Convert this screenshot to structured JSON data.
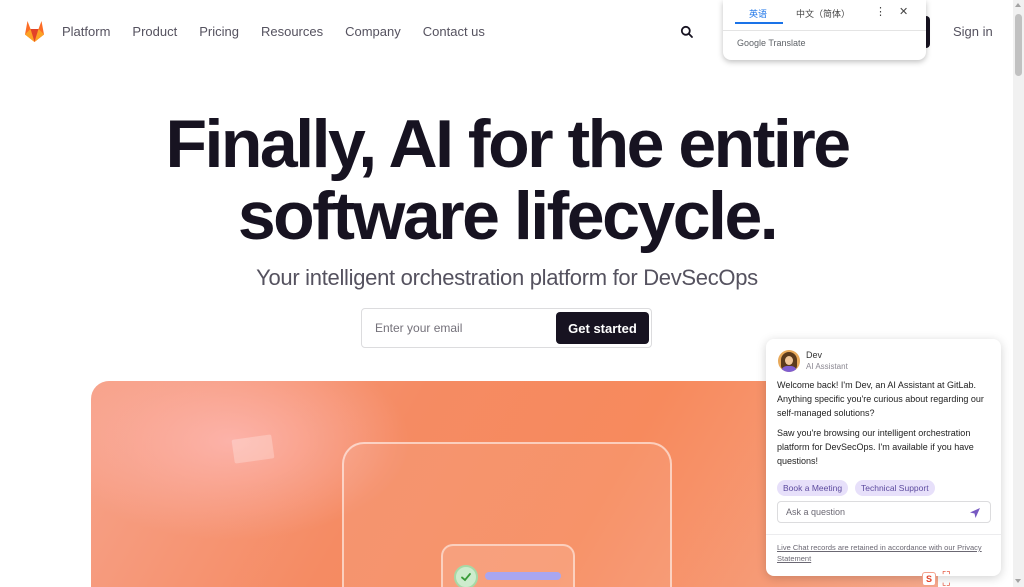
{
  "nav": {
    "logo_icon": "gitlab-tanuki-icon",
    "links": [
      "Platform",
      "Product",
      "Pricing",
      "Resources",
      "Company",
      "Contact us"
    ],
    "search_icon": "search-icon",
    "sign_in": "Sign in"
  },
  "translate_popup": {
    "tab_source": "英语",
    "tab_target": "中文（简体）",
    "more_icon": "more-vertical-icon",
    "close_icon": "close-icon",
    "brand": "Google Translate"
  },
  "hero": {
    "title_line1": "Finally, AI for the entire",
    "title_line2": "software lifecycle.",
    "subtitle": "Your intelligent orchestration platform for DevSecOps",
    "email_placeholder": "Enter your email",
    "cta": "Get started"
  },
  "chat": {
    "agent_name": "Dev",
    "agent_role": "AI Assistant",
    "message1": "Welcome back! I'm Dev, an AI Assistant at GitLab. Anything specific you're curious about regarding our self-managed solutions?",
    "message2": "Saw you're browsing our intelligent orchestration platform for DevSecOps. I'm available if you have questions!",
    "chips": [
      "Book a Meeting",
      "Technical Support"
    ],
    "ask_placeholder": "Ask a question",
    "send_icon": "send-icon",
    "footer": "Live Chat records are retained in accordance with our Privacy Statement"
  },
  "colors": {
    "brand_orange": "#fc6d26",
    "dark": "#171321",
    "chip_bg": "#e7e0fa"
  }
}
